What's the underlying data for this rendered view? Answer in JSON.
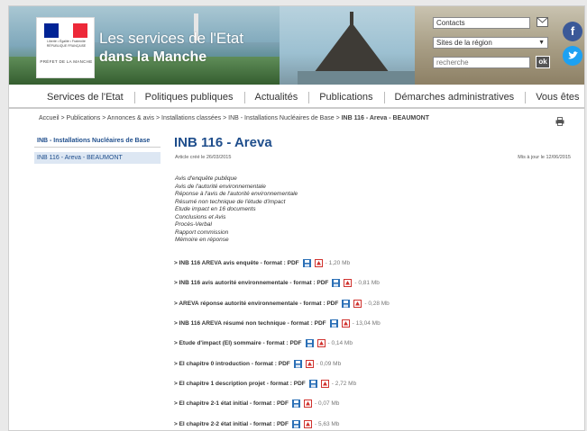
{
  "header": {
    "site_title_line1": "Les services de l'Etat",
    "site_title_line2": "dans la Manche",
    "logo_motto": "Liberté • Égalité • Fraternité RÉPUBLIQUE FRANÇAISE",
    "logo_prefet": "PRÉFET DE LA MANCHE",
    "contacts_label": "Contacts",
    "sites_select_value": "Sites de la région",
    "search_placeholder": "recherche",
    "ok_label": "ok",
    "facebook_glyph": "f",
    "twitter_glyph": "t",
    "flag_colors": [
      "#002395",
      "#ffffff",
      "#ed2939"
    ]
  },
  "nav": {
    "items": [
      "Services de l'Etat",
      "Politiques publiques",
      "Actualités",
      "Publications",
      "Démarches administratives",
      "Vous êtes"
    ]
  },
  "breadcrumb": {
    "path": "Accueil > Publications > Annonces & avis > Installations classées > INB - Installations Nucléaires de Base > ",
    "current": "INB 116 - Areva - BEAUMONT"
  },
  "sidebar": {
    "heading": "INB - Installations Nucléaires de Base",
    "active_item": "INB 116 - Areva - BEAUMONT"
  },
  "main": {
    "title": "INB 116 - Areva",
    "created": "Article créé le 26/03/2015",
    "updated": "Mis à jour le 12/06/2015",
    "intro_lines": [
      "Avis d'enquête publique",
      "Avis de l'autorité environnementale",
      "Réponse à l'avis de l'autorité environnementale",
      "Résumé non technique de l'étude d'impact",
      "Etude impact en 16 documents",
      "Conclusions et Avis",
      "Procès-Verbal",
      "Rapport commission",
      "Mémoire en réponse"
    ],
    "documents": [
      {
        "label": "> INB 116 AREVA avis enquête - format : PDF",
        "size": "- 1,20 Mb"
      },
      {
        "label": "> INB 116 avis autorité environnementale - format : PDF",
        "size": "- 0,81 Mb"
      },
      {
        "label": "> AREVA réponse autorité environnementale - format : PDF",
        "size": "- 0,28 Mb"
      },
      {
        "label": "> INB 116 AREVA résumé non technique - format : PDF",
        "size": "- 13,04 Mb"
      },
      {
        "label": "> Etude d'impact (EI) sommaire - format : PDF",
        "size": "- 0,14 Mb"
      },
      {
        "label": "> EI chapitre 0 introduction - format : PDF",
        "size": "- 0,09 Mb"
      },
      {
        "label": "> EI chapitre 1 description projet - format : PDF",
        "size": "- 2,72 Mb"
      },
      {
        "label": "> EI chapitre 2-1 état initial - format : PDF",
        "size": "- 0,07 Mb"
      },
      {
        "label": "> EI chapitre 2-2 état initial - format : PDF",
        "size": "- 5,63 Mb"
      }
    ]
  },
  "colors": {
    "title_blue": "#1f4e8c",
    "save_icon": "#2a6fb6",
    "pdf_icon": "#d0312d"
  }
}
